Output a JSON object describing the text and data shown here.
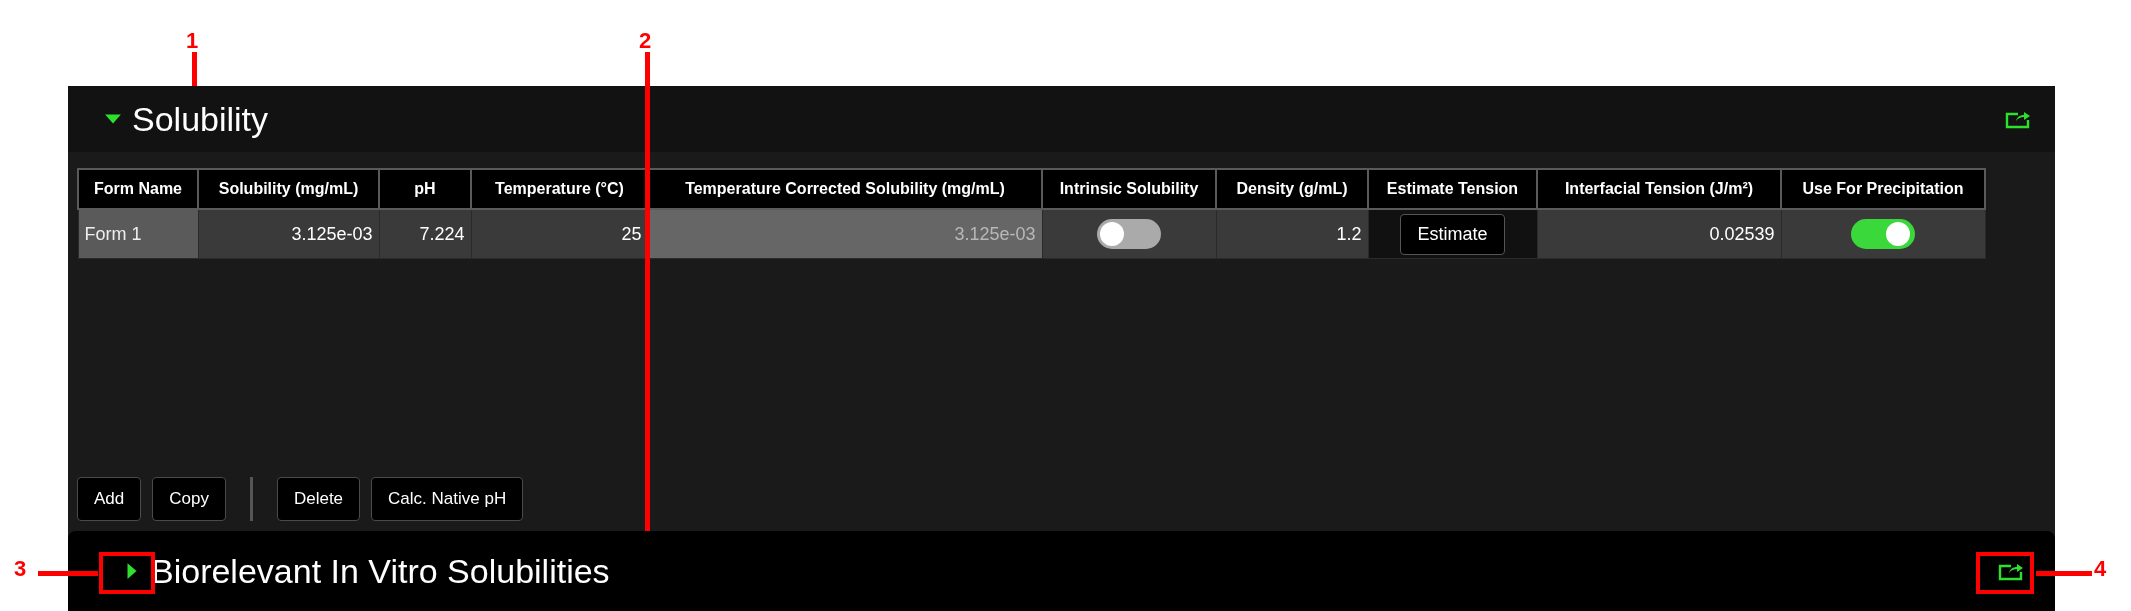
{
  "sections": [
    {
      "title": "Solubility",
      "expanded": true
    },
    {
      "title": "Biorelevant In Vitro Solubilities",
      "expanded": false
    }
  ],
  "table": {
    "columns": [
      "Form Name",
      "Solubility (mg/mL)",
      "pH",
      "Temperature (°C)",
      "Temperature Corrected Solubility (mg/mL)",
      "Intrinsic Solubility",
      "Density (g/mL)",
      "Estimate Tension",
      "Interfacial Tension (J/m²)",
      "Use For Precipitation"
    ],
    "rows": [
      {
        "cells": [
          {
            "kind": "name",
            "text": "Form 1"
          },
          {
            "kind": "number",
            "text": "3.125e-03"
          },
          {
            "kind": "number",
            "text": "7.224"
          },
          {
            "kind": "number",
            "text": "25"
          },
          {
            "kind": "readonly",
            "text": "3.125e-03"
          },
          {
            "kind": "toggle",
            "on": false
          },
          {
            "kind": "number",
            "text": "1.2"
          },
          {
            "kind": "button",
            "text": "Estimate"
          },
          {
            "kind": "number",
            "text": "0.02539"
          },
          {
            "kind": "toggle",
            "on": true
          }
        ]
      }
    ]
  },
  "buttons": [
    "Add",
    "Copy",
    "Delete",
    "Calc. Native pH"
  ],
  "annotations": [
    {
      "label": "1"
    },
    {
      "label": "2"
    },
    {
      "label": "3"
    },
    {
      "label": "4"
    }
  ]
}
